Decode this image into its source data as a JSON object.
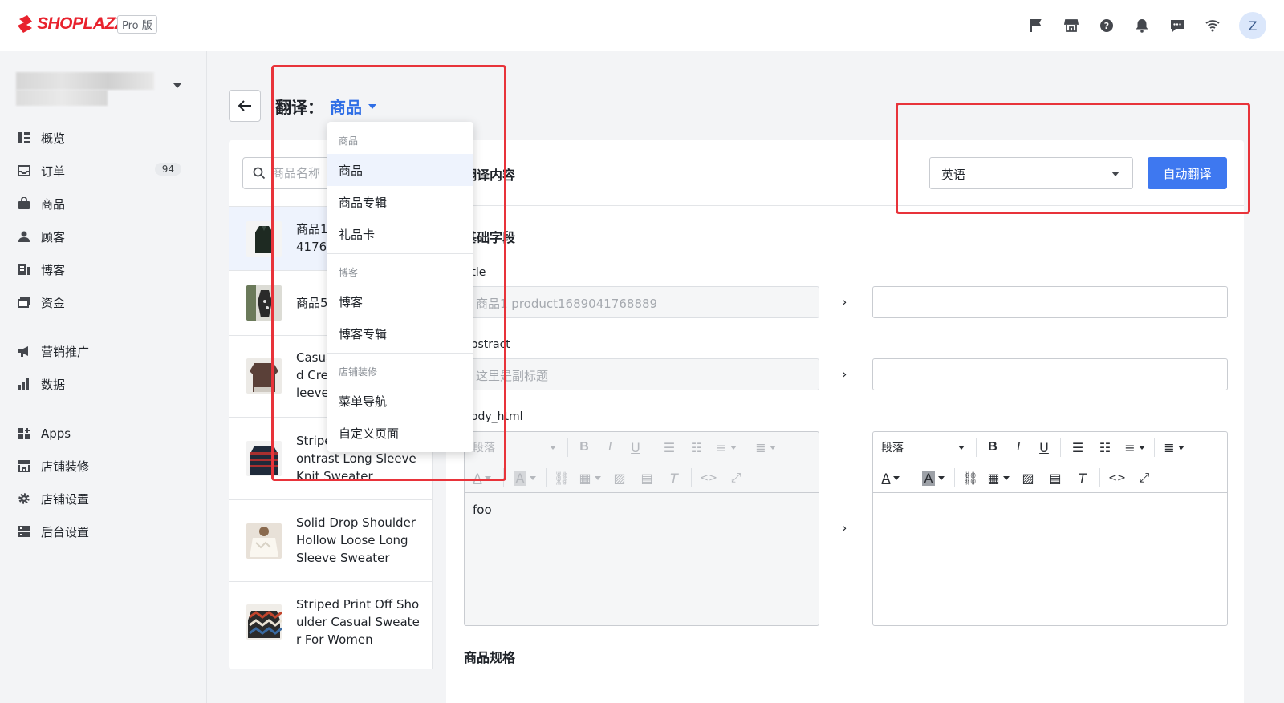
{
  "topbar": {
    "logo_text": "SHOPLAZZA",
    "plan_badge": "Pro 版",
    "avatar_initial": "Z",
    "icons": [
      "flag-icon",
      "store-icon",
      "help-icon",
      "bell-icon",
      "message-icon",
      "wifi-icon"
    ]
  },
  "sidebar": {
    "items": [
      {
        "label": "概览",
        "icon": "dashboard-icon"
      },
      {
        "label": "订单",
        "icon": "inbox-icon",
        "badge": "94"
      },
      {
        "label": "商品",
        "icon": "bag-icon"
      },
      {
        "label": "顾客",
        "icon": "user-icon"
      },
      {
        "label": "博客",
        "icon": "blog-icon"
      },
      {
        "label": "资金",
        "icon": "wallet-icon"
      },
      {
        "label": "营销推广",
        "icon": "megaphone-icon"
      },
      {
        "label": "数据",
        "icon": "bar-chart-icon"
      },
      {
        "label": "Apps",
        "icon": "apps-icon"
      },
      {
        "label": "店铺装修",
        "icon": "storefront-icon"
      },
      {
        "label": "店铺设置",
        "icon": "gear-icon"
      },
      {
        "label": "后台设置",
        "icon": "server-icon"
      }
    ]
  },
  "header": {
    "title_prefix": "翻译：",
    "title_type": "商品"
  },
  "product_list": {
    "search_placeholder": "商品名称",
    "items": [
      {
        "name": "商品1\n4176",
        "active": true
      },
      {
        "name": "商品5"
      },
      {
        "name": "Casua\nd Cre\nleeve"
      },
      {
        "name": "Stripe\nontrast Long Sleeve\nKnit Sweater"
      },
      {
        "name": "Solid Drop Shoulder\nHollow Loose Long\nSleeve Sweater"
      },
      {
        "name": "Striped Print Off Sho\nulder Casual Sweate\nr For Women"
      }
    ]
  },
  "main": {
    "header_title": "翻译内容",
    "language_value": "英语",
    "auto_translate_label": "自动翻译",
    "section_basic": "基础字段",
    "section_variants": "商品规格",
    "fields": {
      "title_label": "title",
      "title_value": "商品1 product1689041768889",
      "abstract_label": "abstract",
      "abstract_value": "这里是副标题",
      "body_label": "body_html",
      "body_value": "foo"
    },
    "editor": {
      "paragraph_label": "段落",
      "arrow": "›"
    }
  },
  "dropdown": {
    "groups": [
      {
        "label": "商品",
        "items": [
          "商品",
          "商品专辑",
          "礼品卡"
        ]
      },
      {
        "label": "博客",
        "items": [
          "博客",
          "博客专辑"
        ]
      },
      {
        "label": "店铺装修",
        "items": [
          "菜单导航",
          "自定义页面"
        ]
      }
    ],
    "selected": "商品"
  },
  "colors": {
    "brand": "#e8222d",
    "primary": "#3e78f0",
    "annotation": "#e8333a"
  }
}
